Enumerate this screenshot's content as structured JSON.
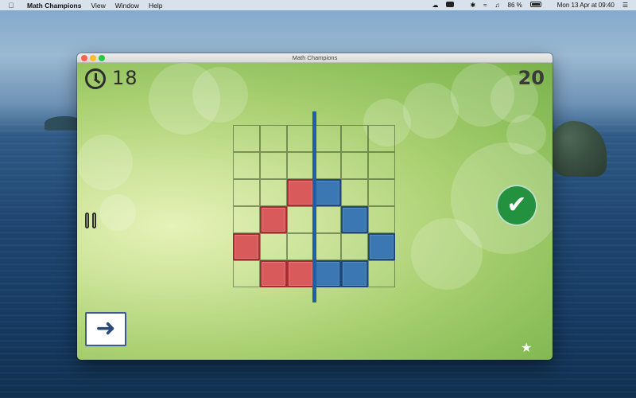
{
  "menubar": {
    "apple_icon": "apple-icon",
    "app_name": "Math Champions",
    "menus": [
      "View",
      "Window",
      "Help"
    ],
    "battery": "86 %",
    "clock": "Mon 13 Apr at  09:40"
  },
  "window": {
    "title": "Math Champions"
  },
  "game": {
    "timer": "18",
    "score": "20",
    "check_icon": "✔",
    "next_icon": "➜",
    "star_icon": "★",
    "grid": {
      "rows": 6,
      "cols": 6,
      "red_cells": [
        [
          2,
          2
        ],
        [
          3,
          1
        ],
        [
          4,
          0
        ],
        [
          5,
          1
        ],
        [
          5,
          2
        ]
      ],
      "blue_cells": [
        [
          2,
          3
        ],
        [
          3,
          4
        ],
        [
          4,
          5
        ],
        [
          5,
          3
        ],
        [
          5,
          4
        ]
      ]
    },
    "colors": {
      "red": "#d95a5a",
      "blue": "#3b78b3",
      "mirror_line": "#1f5fa8",
      "check": "#24913f"
    }
  }
}
